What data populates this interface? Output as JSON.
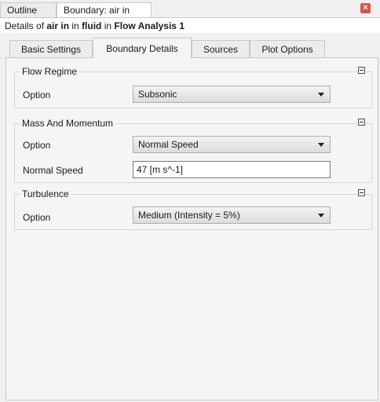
{
  "top_tabs": [
    "Outline",
    "Boundary: air in"
  ],
  "subtitle": {
    "prefix": "Details of ",
    "boundary": "air in",
    "in1": " in ",
    "domain": "fluid",
    "in2": " in ",
    "analysis": "Flow Analysis 1"
  },
  "inner_tabs": [
    "Basic Settings",
    "Boundary Details",
    "Sources",
    "Plot Options"
  ],
  "active_inner_tab": "Boundary Details",
  "groups": {
    "flow_regime": {
      "title": "Flow Regime",
      "option_label": "Option",
      "option_value": "Subsonic"
    },
    "mass_momentum": {
      "title": "Mass And Momentum",
      "option_label": "Option",
      "option_value": "Normal Speed",
      "speed_label": "Normal Speed",
      "speed_value": "47 [m s^-1]"
    },
    "turbulence": {
      "title": "Turbulence",
      "option_label": "Option",
      "option_value": "Medium (Intensity = 5%)"
    }
  },
  "icons": {
    "close": "close-icon",
    "collapse": "collapse-icon",
    "dropdown": "chevron-down-icon"
  },
  "colors": {
    "close_button": "#d9534f",
    "panel_bg": "#f5f5f5"
  }
}
